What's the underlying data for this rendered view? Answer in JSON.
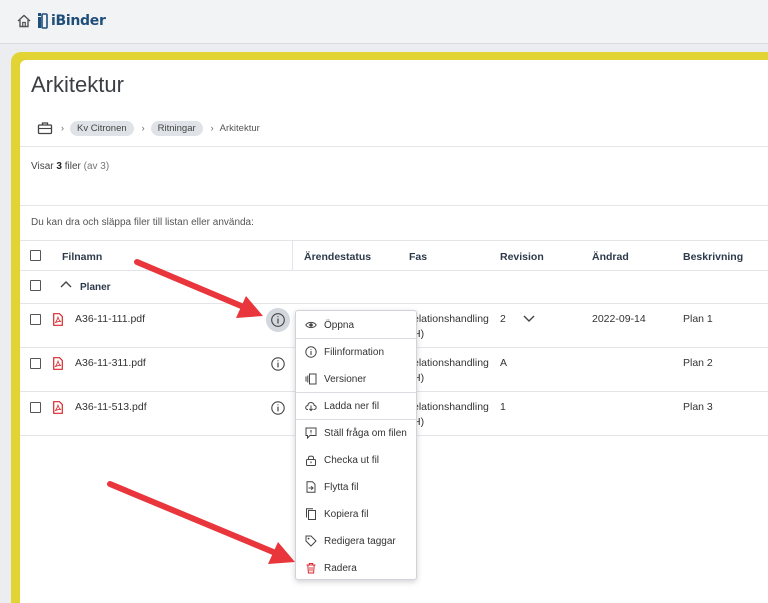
{
  "header": {
    "brand": "iBinder"
  },
  "page": {
    "title": "Arkitektur"
  },
  "breadcrumb": {
    "items": [
      "Kv Citronen",
      "Ritningar"
    ],
    "current": "Arkitektur"
  },
  "summary": {
    "prefix": "Visar",
    "count": "3",
    "unit": "filer",
    "total": "(av 3)"
  },
  "dropzone_text": "Du kan dra och släppa filer till listan eller använda:",
  "table": {
    "columns": [
      "Filnamn",
      "Ärendestatus",
      "Fas",
      "Revision",
      "Ändrad",
      "Beskrivning"
    ],
    "group": "Planer",
    "rows": [
      {
        "filename": "A36-11-111.pdf",
        "fas": "elationshandling",
        "fas2": "H)",
        "revision": "2",
        "changed": "2022-09-14",
        "description": "Plan 1"
      },
      {
        "filename": "A36-11-311.pdf",
        "fas": "elationshandling",
        "fas2": "H)",
        "revision": "A",
        "changed": "",
        "description": "Plan 2"
      },
      {
        "filename": "A36-11-513.pdf",
        "fas": "elationshandling",
        "fas2": "H)",
        "revision": "1",
        "changed": "",
        "description": "Plan 3"
      }
    ]
  },
  "context_menu": {
    "items": [
      "Öppna",
      "Filinformation",
      "Versioner",
      "Ladda ner fil",
      "Ställ fråga om filen",
      "Checka ut fil",
      "Flytta fil",
      "Kopiera fil",
      "Redigera taggar",
      "Radera"
    ],
    "icons": [
      "eye-icon",
      "info-icon",
      "versions-icon",
      "download-icon",
      "question-icon",
      "lock-icon",
      "move-icon",
      "copy-icon",
      "tag-icon",
      "trash-icon"
    ]
  },
  "colors": {
    "frame": "#e2d434",
    "accent": "#1f4e79",
    "danger": "#d9262c",
    "arrow": "#e8363c"
  }
}
